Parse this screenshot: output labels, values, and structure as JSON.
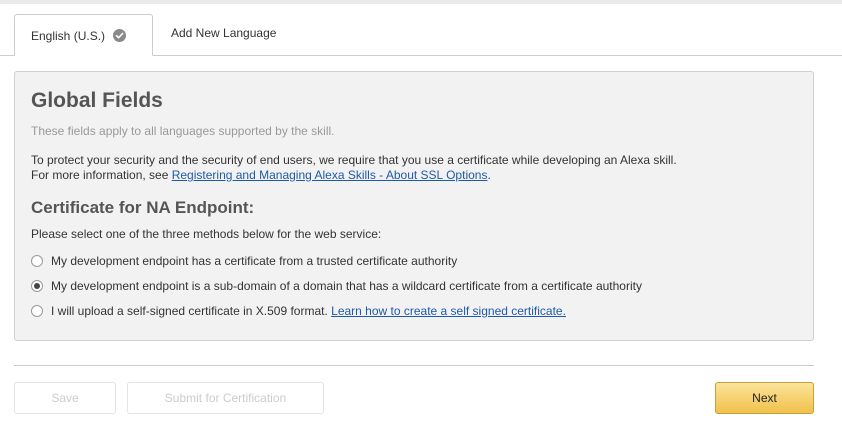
{
  "tabs": {
    "active_label": "English (U.S.)",
    "add_label": "Add New Language"
  },
  "panel": {
    "title": "Global Fields",
    "note": "These fields apply to all languages supported by the skill.",
    "text1": "To protect your security and the security of end users, we require that you use a certificate while developing an Alexa skill.",
    "text2_prefix": "For more information, see ",
    "text2_link": "Registering and Managing Alexa Skills - About SSL Options",
    "text2_suffix": "."
  },
  "certificate": {
    "title": "Certificate for NA Endpoint:",
    "description": "Please select one of the three methods below for the web service:",
    "options": [
      {
        "label": "My development endpoint has a certificate from a trusted certificate authority",
        "checked": false
      },
      {
        "label": "My development endpoint is a sub-domain of a domain that has a wildcard certificate from a certificate authority",
        "checked": true
      },
      {
        "label": "I will upload a self-signed certificate in X.509 format. ",
        "link": "Learn how to create a self signed certificate.",
        "checked": false
      }
    ]
  },
  "buttons": {
    "save": "Save",
    "submit": "Submit for Certification",
    "next": "Next"
  },
  "colors": {
    "next_button": "#f0c14b",
    "link": "#1f5aa8",
    "panel_bg": "#f2f2f2"
  }
}
